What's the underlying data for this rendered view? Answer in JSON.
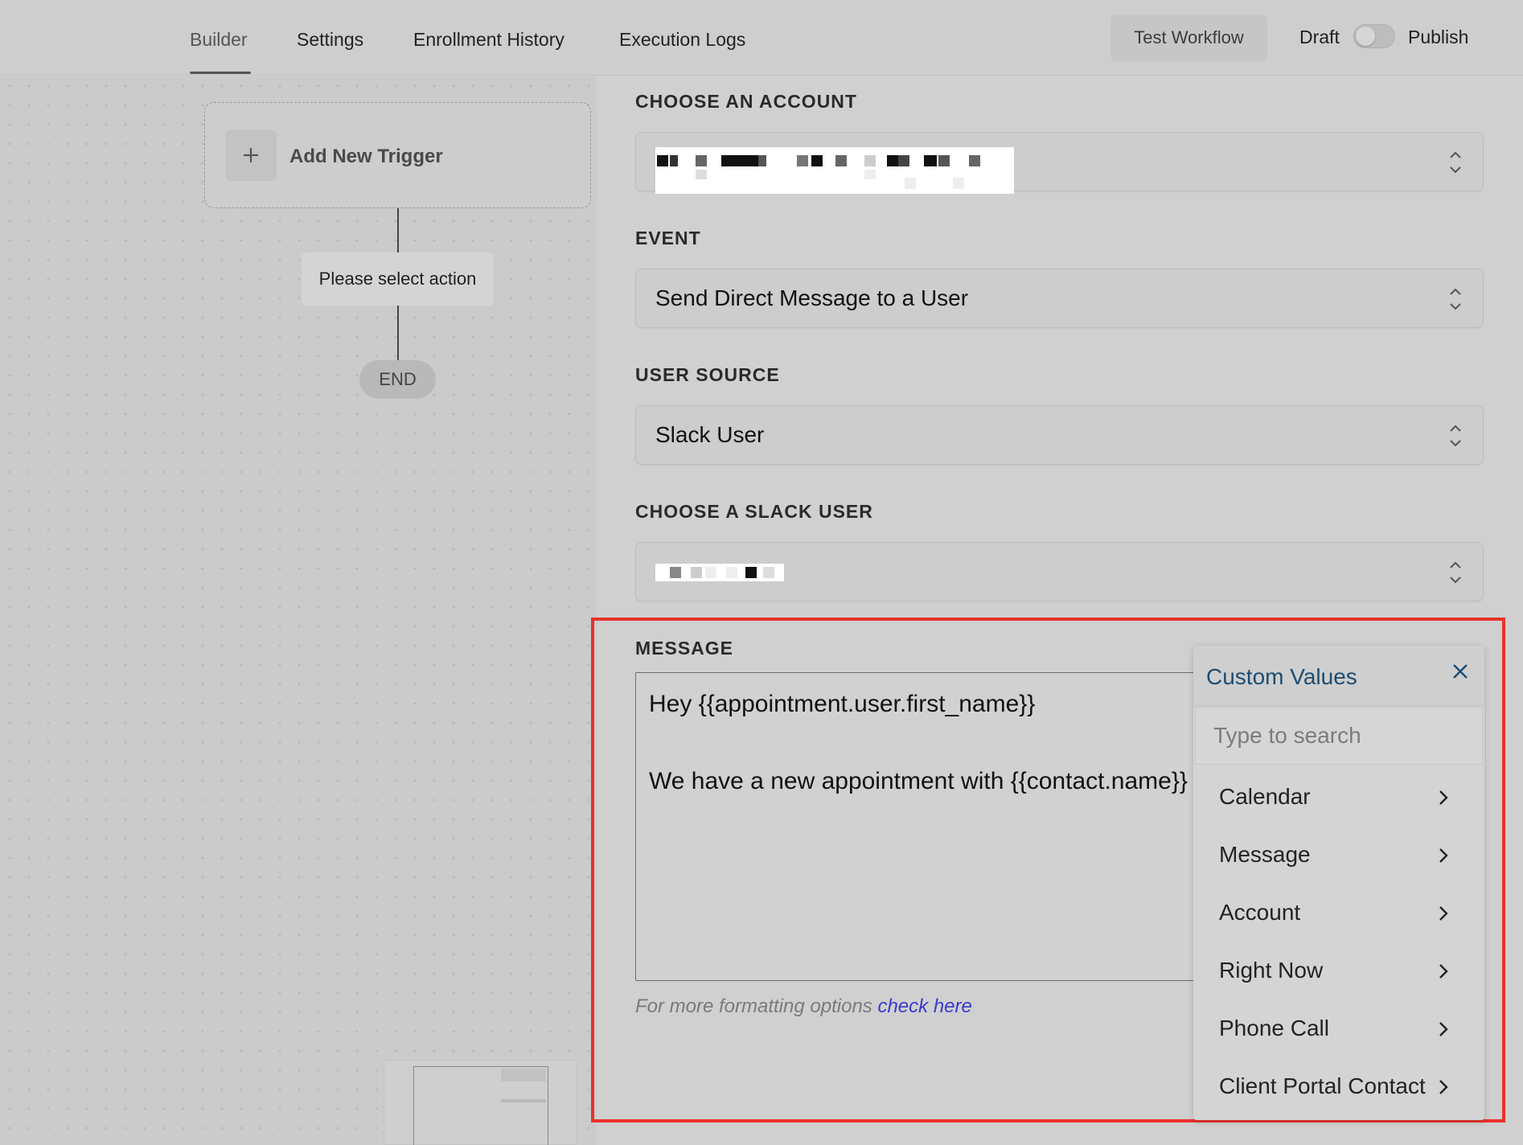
{
  "nav": {
    "tabs": [
      {
        "label": "Builder"
      },
      {
        "label": "Settings"
      },
      {
        "label": "Enrollment History"
      },
      {
        "label": "Execution Logs"
      }
    ],
    "test_workflow": "Test Workflow",
    "draft": "Draft",
    "publish": "Publish"
  },
  "canvas": {
    "trigger_label": "Add New Trigger",
    "action_label": "Please select action",
    "end_label": "END"
  },
  "form": {
    "account_label": "CHOOSE AN ACCOUNT",
    "event_label": "EVENT",
    "event_value": "Send Direct Message to a User",
    "user_source_label": "USER SOURCE",
    "user_source_value": "Slack User",
    "slack_user_label": "CHOOSE A SLACK USER",
    "message_label": "MESSAGE",
    "message_lines": [
      "Hey {{appointment.user.first_name}}",
      "We have a new appointment with {{contact.name}}"
    ],
    "hint_text": "For more formatting options ",
    "hint_link": "check here"
  },
  "custom_values": {
    "title": "Custom Values",
    "search_placeholder": "Type to search",
    "items": [
      {
        "label": "Calendar"
      },
      {
        "label": "Message"
      },
      {
        "label": "Account"
      },
      {
        "label": "Right Now"
      },
      {
        "label": "Phone Call"
      },
      {
        "label": "Client Portal Contact"
      }
    ]
  },
  "colors": {
    "highlight": "#e8312a",
    "link": "#3a3ad0",
    "custom_values_title": "#1d4d72"
  }
}
